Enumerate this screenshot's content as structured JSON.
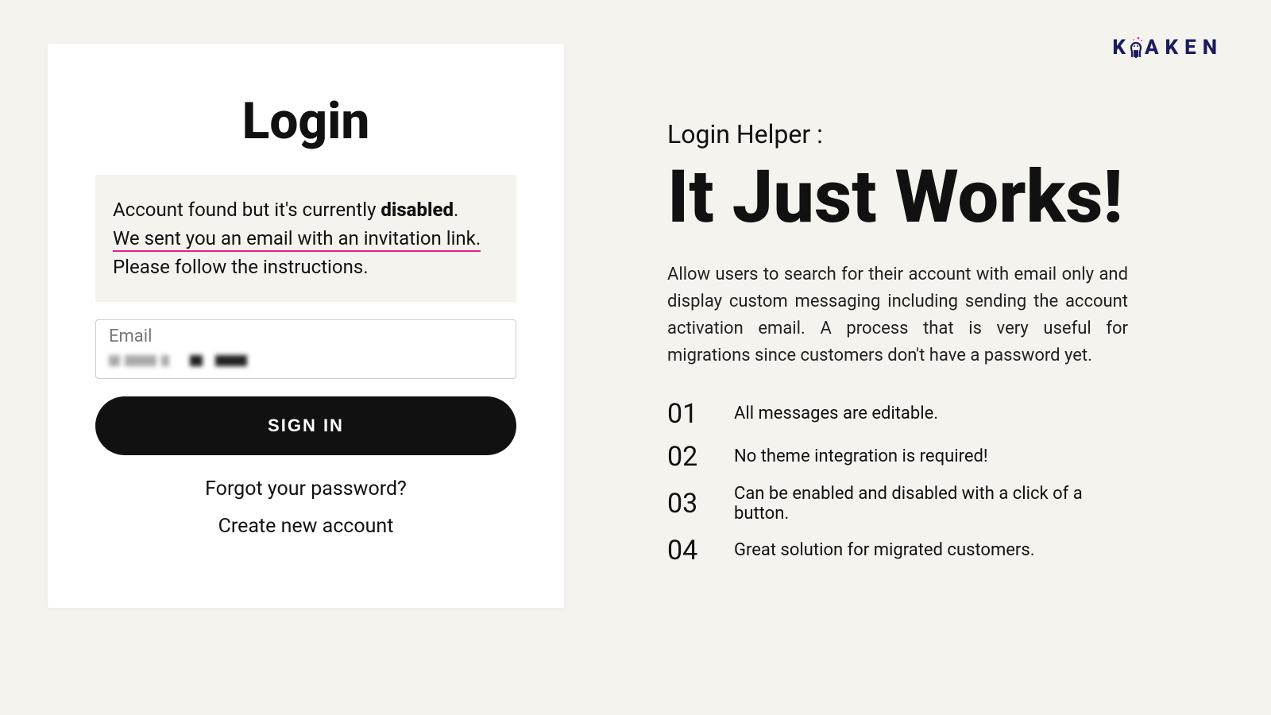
{
  "brand": {
    "name": "KRAKEN"
  },
  "login": {
    "title": "Login",
    "message": {
      "part1": "Account found but it's currently ",
      "bold": "disabled",
      "part2": ".",
      "line2": "We sent you an email with an invitation link.",
      "line3": "Please follow the instructions."
    },
    "field": {
      "label": "Email"
    },
    "button": "SIGN IN",
    "forgot": "Forgot your password?",
    "create": "Create new account"
  },
  "helper": {
    "subtitle": "Login Helper :",
    "headline": "It Just Works!",
    "description": "Allow users to search for their account with email only and display custom messaging including sending the account activation email. A process that is very useful for migrations since customers don't have a password yet.",
    "features": [
      {
        "num": "01",
        "text": "All messages are editable."
      },
      {
        "num": "02",
        "text": "No theme integration is required!"
      },
      {
        "num": "03",
        "text": "Can be enabled and disabled with a click of a button."
      },
      {
        "num": "04",
        "text": "Great solution for migrated customers."
      }
    ]
  }
}
